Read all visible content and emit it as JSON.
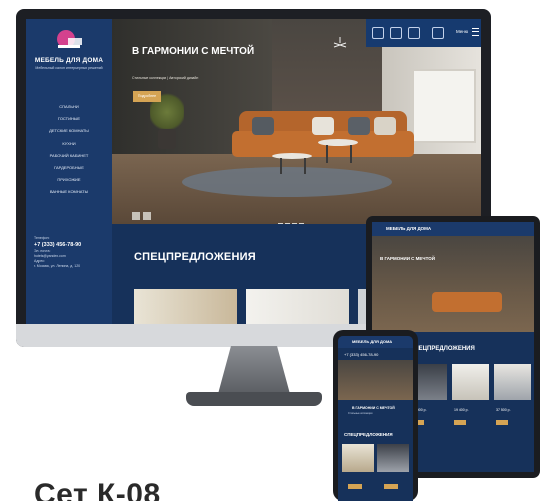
{
  "colors": {
    "primary": "#1b3a6b",
    "accent": "#d5a454",
    "screen_bg": "#16315a"
  },
  "desktop": {
    "logo_text": "МЕБЕЛЬ ДЛЯ ДОМА",
    "logo_sub": "Мебельный салон интерьерных решений",
    "nav": [
      "СПАЛЬНИ",
      "ГОСТИНЫЕ",
      "ДЕТСКИЕ КОМНАТЫ",
      "КУХНИ",
      "РАБОЧИЙ КАБИНЕТ",
      "ГАРДЕРОБНЫЕ",
      "ПРИХОЖИЕ",
      "ВАННЫЕ КОМНАТЫ"
    ],
    "contact_label": "Телефон:",
    "phone": "+7 (333) 456-78-90",
    "email_label": "Эл. почта:",
    "email": "hotels@yandex.com",
    "address_label": "Адрес:",
    "address": "г. Москва, ул. Ленина, д. 120",
    "hero_title": "В ГАРМОНИИ С МЕЧТОЙ",
    "hero_sub": "Стильные коллекции | Авторский дизайн",
    "hero_button": "Подробнее",
    "menu_label": "Меню",
    "specials_title": "СПЕЦПРЕДЛОЖЕНИЯ"
  },
  "tablet": {
    "logo_text": "МЕБЕЛЬ ДЛЯ ДОМА",
    "hero_title": "В ГАРМОНИИ С МЕЧТОЙ",
    "specials_title": "СПЕЦПРЕДЛОЖЕНИЯ",
    "prices": [
      "28 900 р.",
      "19 400 р.",
      "37 500 р."
    ]
  },
  "phone": {
    "logo_text": "МЕБЕЛЬ ДЛЯ ДОМА",
    "phone": "+7 (333) 456-78-90",
    "hero_title": "В ГАРМОНИИ С МЕЧТОЙ",
    "hero_sub": "Стильные коллекции",
    "specials_title": "СПЕЦПРЕДЛОЖЕНИЯ"
  },
  "product_title": "Сет К-08"
}
